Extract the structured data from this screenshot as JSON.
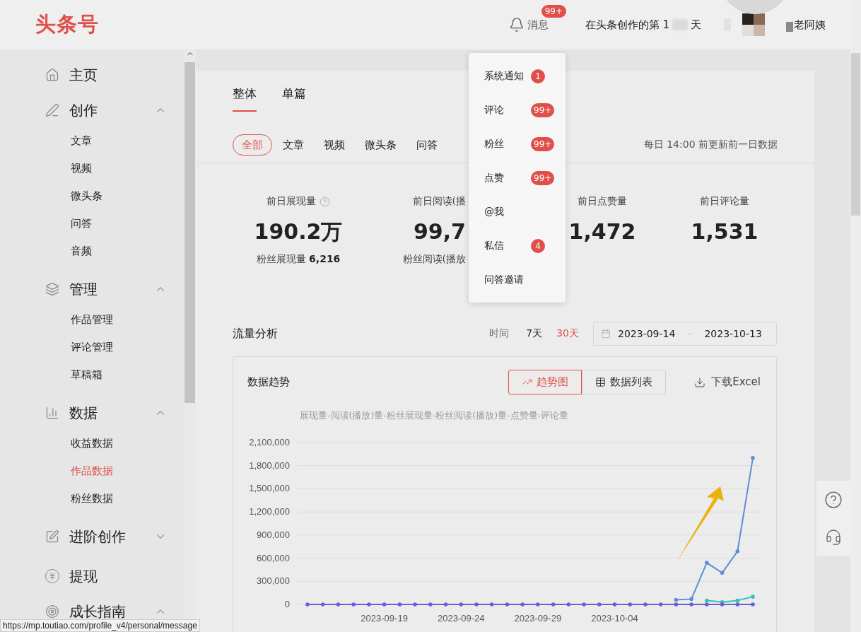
{
  "header": {
    "logo": "头条号",
    "messages": {
      "label": "消息",
      "badge": "99+"
    },
    "days_prefix": "在头条创作的第 1",
    "days_suffix": "天",
    "user_name": "老阿姨"
  },
  "sidebar": {
    "groups": [
      {
        "label": "主页"
      },
      {
        "label": "创作",
        "expanded": true,
        "children": [
          {
            "label": "文章",
            "selected": false
          },
          {
            "label": "视频",
            "selected": false
          },
          {
            "label": "微头条",
            "selected": false
          },
          {
            "label": "问答",
            "selected": false
          },
          {
            "label": "音频",
            "selected": false
          }
        ]
      },
      {
        "label": "管理",
        "expanded": true,
        "children": [
          {
            "label": "作品管理",
            "selected": false
          },
          {
            "label": "评论管理",
            "selected": false
          },
          {
            "label": "草稿箱",
            "selected": false
          }
        ]
      },
      {
        "label": "数据",
        "expanded": true,
        "children": [
          {
            "label": "收益数据",
            "selected": false
          },
          {
            "label": "作品数据",
            "selected": true
          },
          {
            "label": "粉丝数据",
            "selected": false
          }
        ]
      },
      {
        "label": "进阶创作",
        "expanded": false
      },
      {
        "label": "提现"
      },
      {
        "label": "成长指南",
        "expanded": true
      }
    ]
  },
  "main": {
    "tabs": [
      {
        "label": "整体",
        "selected": true
      },
      {
        "label": "单篇",
        "selected": false
      }
    ],
    "filters": [
      {
        "label": "全部",
        "selected": true
      },
      {
        "label": "文章",
        "selected": false
      },
      {
        "label": "视频",
        "selected": false
      },
      {
        "label": "微头条",
        "selected": false
      },
      {
        "label": "问答",
        "selected": false
      }
    ],
    "update_note": "每日 14:00 前更新前一日数据",
    "stats": [
      {
        "label": "前日展现量",
        "help": true,
        "value": "190.2万",
        "sub_label": "粉丝展现量",
        "sub_value": "6,216"
      },
      {
        "label": "前日阅读(播",
        "value": "99,7",
        "sub_label": "粉丝阅读(播放"
      },
      {
        "label": "前日点赞量",
        "value": "1,472"
      },
      {
        "label": "前日评论量",
        "value": "1,531"
      }
    ],
    "traffic": {
      "title": "流量分析",
      "range_label": "时间",
      "ranges": [
        {
          "label": "7天",
          "selected": false
        },
        {
          "label": "30天",
          "selected": true
        }
      ],
      "date_from": "2023-09-14",
      "date_sep": "-",
      "date_to": "2023-10-13"
    },
    "trend": {
      "title": "数据趋势",
      "views": [
        {
          "label": "趋势图",
          "selected": true
        },
        {
          "label": "数据列表",
          "selected": false
        }
      ],
      "download": "下载Excel",
      "legend": "展现量-阅读(播放)量-粉丝展现量-粉丝阅读(播放)量-点赞量-评论量",
      "chart_data": {
        "type": "line",
        "grid": true,
        "categories": [
          null,
          null,
          null,
          null,
          null,
          "2023-09-19",
          null,
          null,
          null,
          null,
          "2023-09-24",
          null,
          null,
          null,
          null,
          "2023-09-29",
          null,
          null,
          null,
          null,
          "2023-10-04",
          null,
          null,
          null,
          null,
          null,
          null,
          null,
          null,
          null
        ],
        "ylim": [
          0,
          2100000
        ],
        "yticks": [
          {
            "value": 0,
            "label": "0"
          },
          {
            "value": 300000,
            "label": "300,000"
          },
          {
            "value": 600000,
            "label": "600,000"
          },
          {
            "value": 900000,
            "label": "900,000"
          },
          {
            "value": 1200000,
            "label": "1,200,000"
          },
          {
            "value": 1500000,
            "label": "1,500,000"
          },
          {
            "value": 1800000,
            "label": "1,800,000"
          },
          {
            "value": 2100000,
            "label": "2,100,000"
          }
        ],
        "series": [
          {
            "color": "#5b8fd6",
            "values": [
              null,
              null,
              null,
              null,
              null,
              null,
              null,
              null,
              null,
              null,
              null,
              null,
              null,
              null,
              null,
              null,
              null,
              null,
              null,
              null,
              null,
              null,
              null,
              null,
              60000,
              70000,
              540000,
              410000,
              690000,
              1900000
            ]
          },
          {
            "color": "#2fc4b2",
            "values": [
              null,
              null,
              null,
              null,
              null,
              null,
              null,
              null,
              null,
              null,
              null,
              null,
              null,
              null,
              null,
              null,
              null,
              null,
              null,
              null,
              null,
              null,
              null,
              null,
              null,
              null,
              50000,
              30000,
              50000,
              100000
            ]
          },
          {
            "color": "#6a5fd8",
            "values": [
              0,
              0,
              0,
              0,
              0,
              0,
              0,
              0,
              0,
              0,
              0,
              0,
              0,
              0,
              0,
              0,
              0,
              0,
              0,
              0,
              0,
              0,
              0,
              0,
              0,
              0,
              0,
              0,
              0,
              0
            ]
          }
        ]
      }
    }
  },
  "message_menu": [
    {
      "label": "系统通知",
      "badge": "1"
    },
    {
      "label": "评论",
      "badge": "99+"
    },
    {
      "label": "粉丝",
      "badge": "99+"
    },
    {
      "label": "点赞",
      "badge": "99+"
    },
    {
      "label": "@我"
    },
    {
      "label": "私信",
      "badge": "4"
    },
    {
      "label": "问答邀请"
    }
  ],
  "status_bar": "https://mp.toutiao.com/profile_v4/personal/message"
}
